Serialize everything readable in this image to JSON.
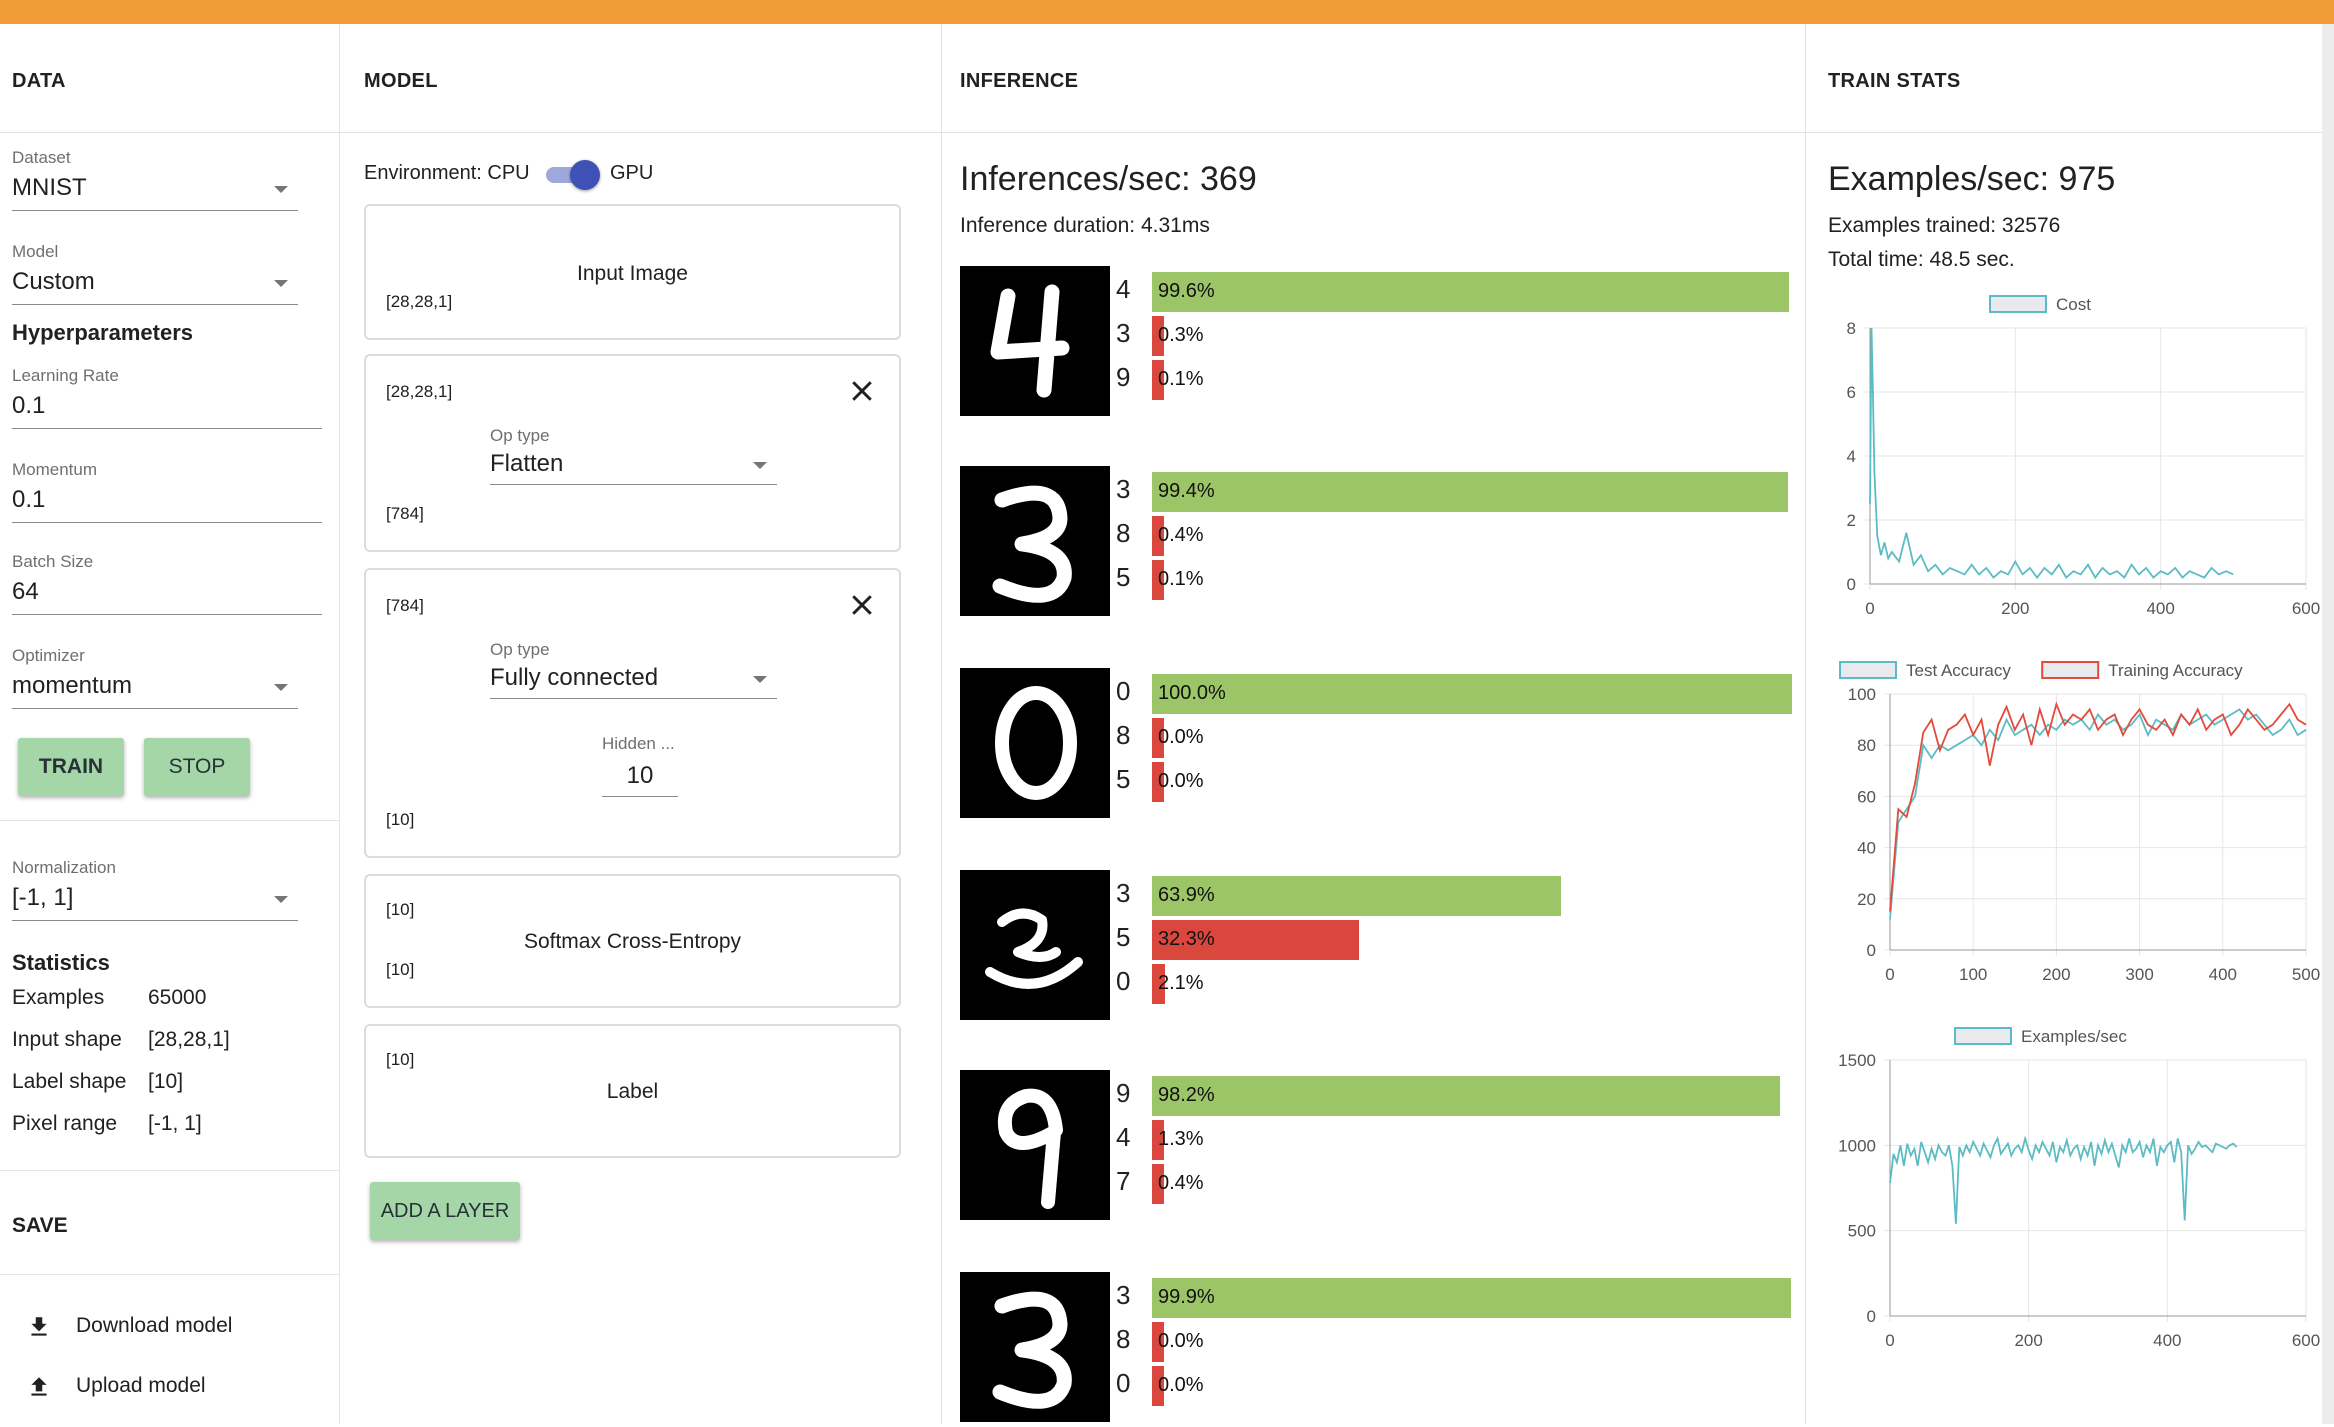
{
  "colors": {
    "top_bar": "#f29c37",
    "button_bg": "#a5d6a7",
    "bar_top": "#9cc567",
    "bar_other": "#d9473d",
    "toggle": "#3f51b5"
  },
  "data": {
    "header": "DATA",
    "dataset": {
      "label": "Dataset",
      "value": "MNIST"
    },
    "model": {
      "label": "Model",
      "value": "Custom"
    },
    "hyper_title": "Hyperparameters",
    "learning_rate": {
      "label": "Learning Rate",
      "value": "0.1"
    },
    "momentum": {
      "label": "Momentum",
      "value": "0.1"
    },
    "batch_size": {
      "label": "Batch Size",
      "value": "64"
    },
    "optimizer": {
      "label": "Optimizer",
      "value": "momentum"
    },
    "train_label": "TRAIN",
    "stop_label": "STOP",
    "normalization": {
      "label": "Normalization",
      "value": "[-1, 1]"
    },
    "stats_title": "Statistics",
    "stats": [
      {
        "label": "Examples",
        "value": "65000"
      },
      {
        "label": "Input shape",
        "value": "[28,28,1]"
      },
      {
        "label": "Label shape",
        "value": "[10]"
      },
      {
        "label": "Pixel range",
        "value": "[-1, 1]"
      }
    ],
    "save_title": "SAVE",
    "download_label": "Download model",
    "upload_label": "Upload model",
    "download_icon": "download-icon",
    "upload_icon": "upload-icon"
  },
  "model": {
    "header": "MODEL",
    "env_label": "Environment: CPU",
    "gpu_label": "GPU",
    "gpu_enabled": true,
    "input_card": {
      "title": "Input Image",
      "shape": "[28,28,1]"
    },
    "flatten_card": {
      "in_shape": "[28,28,1]",
      "optype_label": "Op type",
      "optype_value": "Flatten",
      "out_shape": "[784]"
    },
    "fc_card": {
      "in_shape": "[784]",
      "optype_label": "Op type",
      "optype_value": "Fully connected",
      "hidden_label": "Hidden ...",
      "hidden_value": "10",
      "out_shape": "[10]"
    },
    "softmax_card": {
      "in_shape": "[10]",
      "title": "Softmax Cross-Entropy",
      "out_shape": "[10]"
    },
    "label_card": {
      "shape": "[10]",
      "title": "Label"
    },
    "add_layer_label": "ADD A LAYER",
    "close_icon": "close-icon"
  },
  "inference": {
    "header": "INFERENCE",
    "rate": "Inferences/sec: 369",
    "duration": "Inference duration: 4.31ms",
    "items": [
      {
        "digit": "4",
        "preds": [
          {
            "label": "4",
            "pct": "99.6%",
            "value": 0.996
          },
          {
            "label": "3",
            "pct": "0.3%",
            "value": 0.003
          },
          {
            "label": "9",
            "pct": "0.1%",
            "value": 0.001
          }
        ]
      },
      {
        "digit": "3",
        "preds": [
          {
            "label": "3",
            "pct": "99.4%",
            "value": 0.994
          },
          {
            "label": "8",
            "pct": "0.4%",
            "value": 0.004
          },
          {
            "label": "5",
            "pct": "0.1%",
            "value": 0.001
          }
        ]
      },
      {
        "digit": "0",
        "preds": [
          {
            "label": "0",
            "pct": "100.0%",
            "value": 1.0
          },
          {
            "label": "8",
            "pct": "0.0%",
            "value": 0.0
          },
          {
            "label": "5",
            "pct": "0.0%",
            "value": 0.0
          }
        ]
      },
      {
        "digit": "2",
        "preds": [
          {
            "label": "3",
            "pct": "63.9%",
            "value": 0.639
          },
          {
            "label": "5",
            "pct": "32.3%",
            "value": 0.323
          },
          {
            "label": "0",
            "pct": "2.1%",
            "value": 0.021
          }
        ]
      },
      {
        "digit": "9",
        "preds": [
          {
            "label": "9",
            "pct": "98.2%",
            "value": 0.982
          },
          {
            "label": "4",
            "pct": "1.3%",
            "value": 0.013
          },
          {
            "label": "7",
            "pct": "0.4%",
            "value": 0.004
          }
        ]
      },
      {
        "digit": "3",
        "preds": [
          {
            "label": "3",
            "pct": "99.9%",
            "value": 0.999
          },
          {
            "label": "8",
            "pct": "0.0%",
            "value": 0.0
          },
          {
            "label": "0",
            "pct": "0.0%",
            "value": 0.0
          }
        ]
      }
    ]
  },
  "train": {
    "header": "TRAIN STATS",
    "rate": "Examples/sec: 975",
    "trained": "Examples trained: 32576",
    "time": "Total time: 48.5 sec."
  },
  "chart_data": [
    {
      "type": "line",
      "legend": "Cost",
      "xlim": [
        0,
        600
      ],
      "ylim": [
        0,
        8
      ],
      "xticks": [
        0,
        200,
        400,
        600
      ],
      "yticks": [
        0,
        2,
        4,
        6,
        8
      ],
      "grid": true,
      "legend_position": "top",
      "series": [
        {
          "name": "Cost",
          "color": "#5bbcc4",
          "x": [
            0,
            2,
            4,
            6,
            10,
            15,
            20,
            25,
            30,
            40,
            50,
            60,
            70,
            80,
            90,
            100,
            110,
            120,
            130,
            140,
            150,
            160,
            170,
            180,
            190,
            200,
            210,
            220,
            230,
            240,
            250,
            260,
            270,
            280,
            290,
            300,
            310,
            320,
            330,
            340,
            350,
            360,
            370,
            380,
            390,
            400,
            410,
            420,
            430,
            440,
            450,
            460,
            470,
            480,
            490,
            500
          ],
          "y": [
            2.5,
            8.0,
            6.0,
            3.5,
            1.5,
            0.9,
            1.3,
            0.8,
            1.0,
            0.7,
            1.6,
            0.6,
            0.9,
            0.4,
            0.6,
            0.3,
            0.5,
            0.4,
            0.3,
            0.6,
            0.3,
            0.5,
            0.2,
            0.4,
            0.3,
            0.7,
            0.3,
            0.5,
            0.2,
            0.5,
            0.3,
            0.6,
            0.2,
            0.4,
            0.3,
            0.6,
            0.2,
            0.5,
            0.3,
            0.4,
            0.2,
            0.6,
            0.3,
            0.5,
            0.2,
            0.4,
            0.3,
            0.5,
            0.2,
            0.4,
            0.3,
            0.2,
            0.5,
            0.3,
            0.4,
            0.3
          ]
        }
      ]
    },
    {
      "type": "line",
      "xlim": [
        0,
        500
      ],
      "ylim": [
        0,
        100
      ],
      "xticks": [
        0,
        100,
        200,
        300,
        400,
        500
      ],
      "yticks": [
        0,
        20,
        40,
        60,
        80,
        100
      ],
      "grid": true,
      "legend_position": "top",
      "series": [
        {
          "name": "Test Accuracy",
          "color": "#5bbcc4",
          "x": [
            0,
            10,
            20,
            30,
            40,
            50,
            60,
            70,
            80,
            90,
            100,
            110,
            120,
            130,
            140,
            150,
            160,
            170,
            180,
            190,
            200,
            210,
            220,
            230,
            240,
            250,
            260,
            270,
            280,
            290,
            300,
            310,
            320,
            330,
            340,
            350,
            360,
            370,
            380,
            390,
            400,
            410,
            420,
            430,
            440,
            450,
            460,
            470,
            480,
            490,
            500
          ],
          "y": [
            12,
            50,
            55,
            60,
            80,
            75,
            80,
            78,
            80,
            82,
            84,
            80,
            86,
            82,
            90,
            84,
            86,
            88,
            84,
            88,
            86,
            90,
            88,
            90,
            86,
            92,
            88,
            90,
            86,
            88,
            92,
            84,
            90,
            88,
            86,
            92,
            88,
            90,
            92,
            88,
            90,
            92,
            94,
            90,
            92,
            88,
            84,
            86,
            90,
            84,
            86
          ]
        },
        {
          "name": "Training Accuracy",
          "color": "#e34a3c",
          "x": [
            0,
            10,
            20,
            30,
            40,
            50,
            60,
            70,
            80,
            90,
            100,
            110,
            120,
            130,
            140,
            150,
            160,
            170,
            180,
            190,
            200,
            210,
            220,
            230,
            240,
            250,
            260,
            270,
            280,
            290,
            300,
            310,
            320,
            330,
            340,
            350,
            360,
            370,
            380,
            390,
            400,
            410,
            420,
            430,
            440,
            450,
            460,
            470,
            480,
            490,
            500
          ],
          "y": [
            15,
            55,
            52,
            65,
            85,
            90,
            78,
            86,
            88,
            92,
            84,
            90,
            72,
            88,
            95,
            86,
            92,
            80,
            94,
            84,
            96,
            88,
            92,
            90,
            94,
            86,
            90,
            92,
            84,
            90,
            94,
            88,
            86,
            90,
            84,
            92,
            88,
            94,
            86,
            90,
            92,
            84,
            88,
            94,
            90,
            86,
            88,
            92,
            96,
            90,
            88
          ]
        }
      ]
    },
    {
      "type": "line",
      "legend": "Examples/sec",
      "xlim": [
        0,
        600
      ],
      "ylim": [
        0,
        1500
      ],
      "xticks": [
        0,
        200,
        400,
        600
      ],
      "yticks": [
        0,
        500,
        1000,
        1500
      ],
      "grid": true,
      "legend_position": "top",
      "series": [
        {
          "name": "Examples/sec",
          "color": "#5bbcc4",
          "x": [
            0,
            5,
            10,
            15,
            20,
            25,
            30,
            35,
            40,
            45,
            50,
            55,
            60,
            65,
            70,
            75,
            80,
            85,
            90,
            95,
            100,
            105,
            110,
            115,
            120,
            125,
            130,
            135,
            140,
            145,
            150,
            155,
            160,
            165,
            170,
            175,
            180,
            185,
            190,
            195,
            200,
            205,
            210,
            215,
            220,
            225,
            230,
            235,
            240,
            245,
            250,
            255,
            260,
            265,
            270,
            275,
            280,
            285,
            290,
            295,
            300,
            305,
            310,
            315,
            320,
            325,
            330,
            335,
            340,
            345,
            350,
            355,
            360,
            365,
            370,
            375,
            380,
            385,
            390,
            395,
            400,
            405,
            410,
            415,
            420,
            425,
            430,
            435,
            440,
            445,
            450,
            455,
            460,
            465,
            470,
            475,
            480,
            485,
            490,
            495,
            500
          ],
          "y": [
            780,
            950,
            900,
            1000,
            880,
            1010,
            940,
            980,
            880,
            1020,
            960,
            900,
            980,
            920,
            1000,
            960,
            940,
            1000,
            880,
            540,
            990,
            940,
            1000,
            960,
            1020,
            980,
            940,
            1010,
            970,
            930,
            1000,
            1040,
            950,
            980,
            1010,
            940,
            980,
            1000,
            960,
            1040,
            970,
            920,
            1000,
            960,
            1020,
            980,
            940,
            1020,
            900,
            990,
            960,
            1030,
            940,
            980,
            1000,
            920,
            990,
            940,
            1020,
            880,
            1000,
            950,
            1030,
            960,
            1010,
            940,
            870,
            1000,
            960,
            1040,
            960,
            980,
            1020,
            930,
            1000,
            960,
            1040,
            880,
            990,
            960,
            1000,
            1020,
            900,
            1040,
            960,
            560,
            1000,
            950,
            980,
            1020,
            990,
            1000,
            980,
            960,
            1010,
            1000,
            990,
            980,
            1000,
            1010,
            990
          ]
        }
      ]
    }
  ]
}
